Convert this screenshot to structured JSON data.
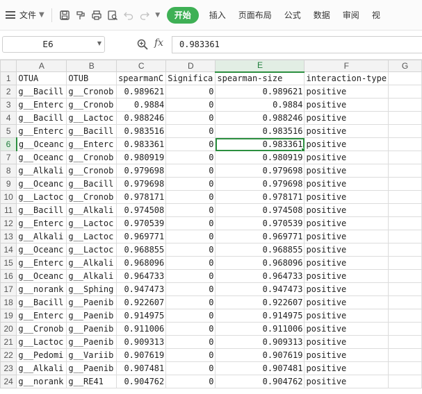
{
  "toolbar": {
    "file_menu": "文件",
    "tabs": [
      {
        "label": "开始",
        "active": true
      },
      {
        "label": "插入",
        "active": false
      },
      {
        "label": "页面布局",
        "active": false
      },
      {
        "label": "公式",
        "active": false
      },
      {
        "label": "数据",
        "active": false
      },
      {
        "label": "审阅",
        "active": false
      },
      {
        "label": "视",
        "active": false
      }
    ],
    "icons": [
      "save-icon",
      "format-painter-icon",
      "print-icon",
      "print-preview-icon",
      "undo-icon",
      "redo-icon"
    ],
    "accent_color": "#3eb055"
  },
  "formula_bar": {
    "name_box": "E6",
    "fx_label": "fx",
    "value": "0.983361"
  },
  "grid": {
    "columns": [
      "A",
      "B",
      "C",
      "D",
      "E",
      "F",
      "G"
    ],
    "active_column": "E",
    "active_row": "6",
    "selected_cell": "E6",
    "selection_color": "#2b8f3f",
    "rows": [
      {
        "n": "1",
        "cells": [
          "OTUA",
          "OTUB",
          "spearmanC",
          "Significa",
          "spearman-size",
          "interaction-type",
          ""
        ]
      },
      {
        "n": "2",
        "cells": [
          "g__Bacill",
          "g__Cronob",
          "0.989621",
          "0",
          "0.989621",
          "positive",
          ""
        ]
      },
      {
        "n": "3",
        "cells": [
          "g__Enterc",
          "g__Cronob",
          "0.9884",
          "0",
          "0.9884",
          "positive",
          ""
        ]
      },
      {
        "n": "4",
        "cells": [
          "g__Bacill",
          "g__Lactoc",
          "0.988246",
          "0",
          "0.988246",
          "positive",
          ""
        ]
      },
      {
        "n": "5",
        "cells": [
          "g__Enterc",
          "g__Bacill",
          "0.983516",
          "0",
          "0.983516",
          "positive",
          ""
        ]
      },
      {
        "n": "6",
        "cells": [
          "g__Oceanc",
          "g__Enterc",
          "0.983361",
          "0",
          "0.983361",
          "positive",
          ""
        ]
      },
      {
        "n": "7",
        "cells": [
          "g__Oceanc",
          "g__Cronob",
          "0.980919",
          "0",
          "0.980919",
          "positive",
          ""
        ]
      },
      {
        "n": "8",
        "cells": [
          "g__Alkali",
          "g__Cronob",
          "0.979698",
          "0",
          "0.979698",
          "positive",
          ""
        ]
      },
      {
        "n": "9",
        "cells": [
          "g__Oceanc",
          "g__Bacill",
          "0.979698",
          "0",
          "0.979698",
          "positive",
          ""
        ]
      },
      {
        "n": "10",
        "cells": [
          "g__Lactoc",
          "g__Cronob",
          "0.978171",
          "0",
          "0.978171",
          "positive",
          ""
        ]
      },
      {
        "n": "11",
        "cells": [
          "g__Bacill",
          "g__Alkali",
          "0.974508",
          "0",
          "0.974508",
          "positive",
          ""
        ]
      },
      {
        "n": "12",
        "cells": [
          "g__Enterc",
          "g__Lactoc",
          "0.970539",
          "0",
          "0.970539",
          "positive",
          ""
        ]
      },
      {
        "n": "13",
        "cells": [
          "g__Alkali",
          "g__Lactoc",
          "0.969771",
          "0",
          "0.969771",
          "positive",
          ""
        ]
      },
      {
        "n": "14",
        "cells": [
          "g__Oceanc",
          "g__Lactoc",
          "0.968855",
          "0",
          "0.968855",
          "positive",
          ""
        ]
      },
      {
        "n": "15",
        "cells": [
          "g__Enterc",
          "g__Alkali",
          "0.968096",
          "0",
          "0.968096",
          "positive",
          ""
        ]
      },
      {
        "n": "16",
        "cells": [
          "g__Oceanc",
          "g__Alkali",
          "0.964733",
          "0",
          "0.964733",
          "positive",
          ""
        ]
      },
      {
        "n": "17",
        "cells": [
          "g__norank",
          "g__Sphing",
          "0.947473",
          "0",
          "0.947473",
          "positive",
          ""
        ]
      },
      {
        "n": "18",
        "cells": [
          "g__Bacill",
          "g__Paenib",
          "0.922607",
          "0",
          "0.922607",
          "positive",
          ""
        ]
      },
      {
        "n": "19",
        "cells": [
          "g__Enterc",
          "g__Paenib",
          "0.914975",
          "0",
          "0.914975",
          "positive",
          ""
        ]
      },
      {
        "n": "20",
        "cells": [
          "g__Cronob",
          "g__Paenib",
          "0.911006",
          "0",
          "0.911006",
          "positive",
          ""
        ]
      },
      {
        "n": "21",
        "cells": [
          "g__Lactoc",
          "g__Paenib",
          "0.909313",
          "0",
          "0.909313",
          "positive",
          ""
        ]
      },
      {
        "n": "22",
        "cells": [
          "g__Pedomi",
          "g__Variib",
          "0.907619",
          "0",
          "0.907619",
          "positive",
          ""
        ]
      },
      {
        "n": "23",
        "cells": [
          "g__Alkali",
          "g__Paenib",
          "0.907481",
          "0",
          "0.907481",
          "positive",
          ""
        ]
      },
      {
        "n": "24",
        "cells": [
          "g__norank",
          "g__RE41",
          "0.904762",
          "0",
          "0.904762",
          "positive",
          ""
        ]
      }
    ]
  }
}
